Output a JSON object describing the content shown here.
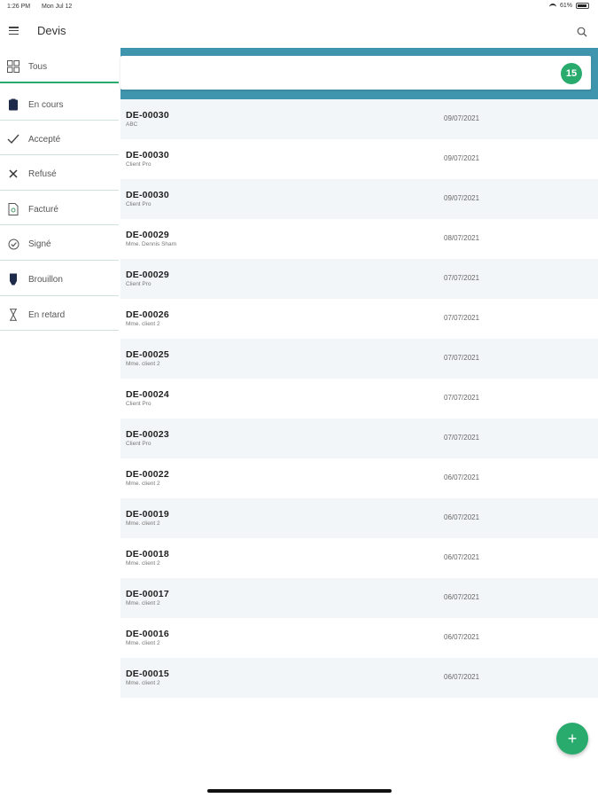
{
  "status_bar": {
    "time": "1:26 PM",
    "date": "Mon Jul 12",
    "battery": "61%"
  },
  "app": {
    "title": "Devis",
    "menu_icon": "hamburger-icon",
    "search_icon": "search-icon"
  },
  "header": {
    "count": "15"
  },
  "sidebar": {
    "items": [
      {
        "label": "Tous",
        "icon": "grid-icon"
      },
      {
        "label": "En cours",
        "icon": "clipboard-icon"
      },
      {
        "label": "Accepté",
        "icon": "checkmark-icon"
      },
      {
        "label": "Refusé",
        "icon": "close-icon"
      },
      {
        "label": "Facturé",
        "icon": "invoice-icon"
      },
      {
        "label": "Signé",
        "icon": "signed-icon"
      },
      {
        "label": "Brouillon",
        "icon": "draft-icon"
      },
      {
        "label": "En retard",
        "icon": "hourglass-icon"
      }
    ]
  },
  "quotes": [
    {
      "number": "DE-00030",
      "client": "ABC",
      "date": "09/07/2021"
    },
    {
      "number": "DE-00030",
      "client": "Client Pro",
      "date": "09/07/2021"
    },
    {
      "number": "DE-00030",
      "client": "Client Pro",
      "date": "09/07/2021"
    },
    {
      "number": "DE-00029",
      "client": "Mme. Dennis Sham",
      "date": "08/07/2021"
    },
    {
      "number": "DE-00029",
      "client": "Client Pro",
      "date": "07/07/2021"
    },
    {
      "number": "DE-00026",
      "client": "Mme. client 2",
      "date": "07/07/2021"
    },
    {
      "number": "DE-00025",
      "client": "Mme. client 2",
      "date": "07/07/2021"
    },
    {
      "number": "DE-00024",
      "client": "Client Pro",
      "date": "07/07/2021"
    },
    {
      "number": "DE-00023",
      "client": "Client Pro",
      "date": "07/07/2021"
    },
    {
      "number": "DE-00022",
      "client": "Mme. client 2",
      "date": "06/07/2021"
    },
    {
      "number": "DE-00019",
      "client": "Mme. client 2",
      "date": "06/07/2021"
    },
    {
      "number": "DE-00018",
      "client": "Mme. client 2",
      "date": "06/07/2021"
    },
    {
      "number": "DE-00017",
      "client": "Mme. client 2",
      "date": "06/07/2021"
    },
    {
      "number": "DE-00016",
      "client": "Mme. client 2",
      "date": "06/07/2021"
    },
    {
      "number": "DE-00015",
      "client": "Mme. client 2",
      "date": "06/07/2021"
    }
  ],
  "fab": {
    "label": "+",
    "icon": "plus-icon"
  },
  "colors": {
    "accent": "#2aab6e",
    "header": "#3f95ad"
  }
}
